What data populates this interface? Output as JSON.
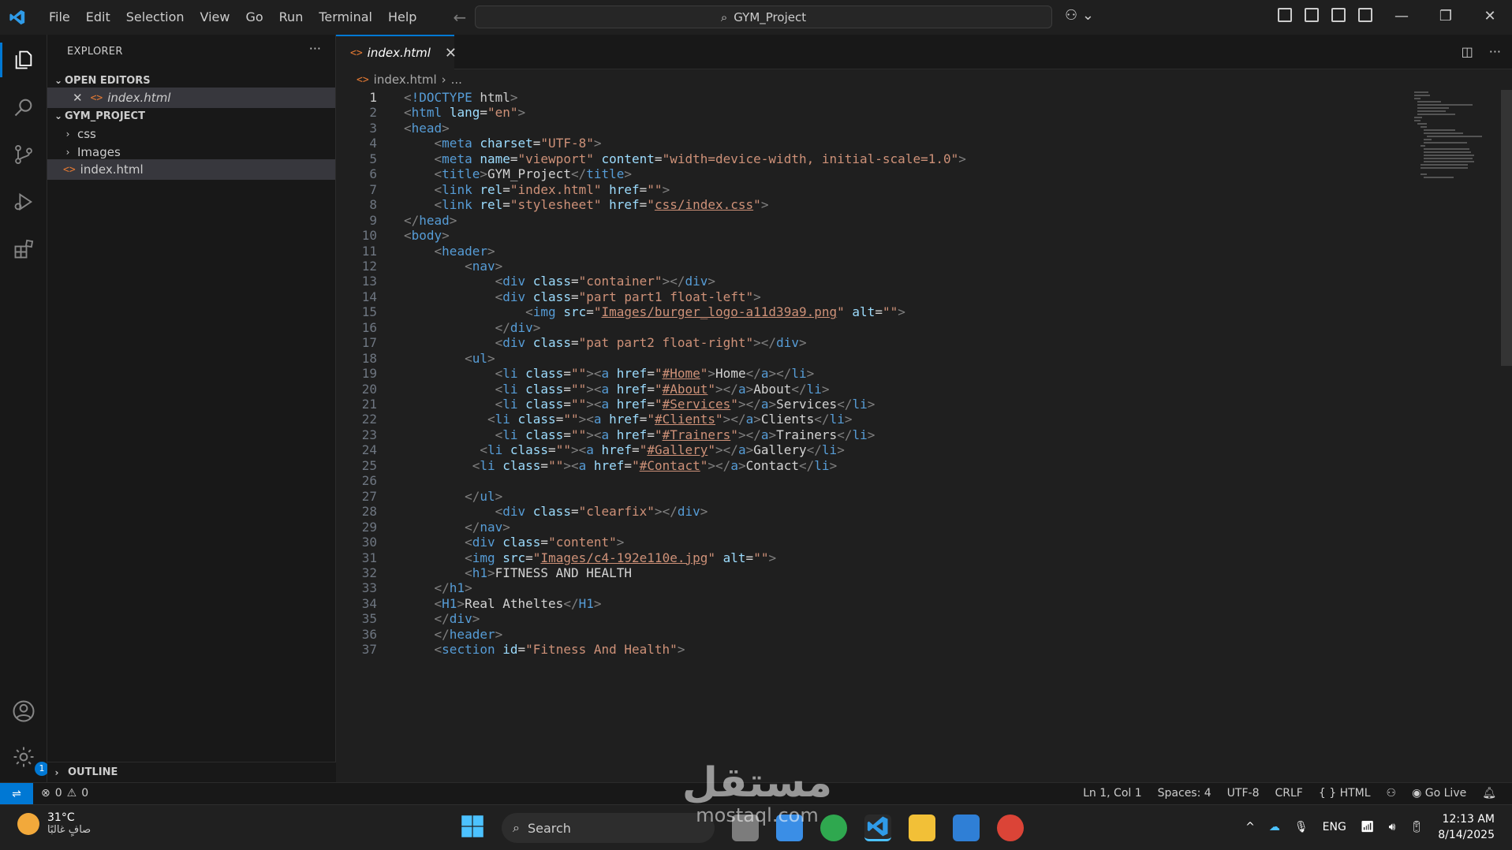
{
  "titlebar": {
    "menu": [
      "File",
      "Edit",
      "Selection",
      "View",
      "Go",
      "Run",
      "Terminal",
      "Help"
    ],
    "search": "GYM_Project"
  },
  "sidebar": {
    "title": "EXPLORER",
    "open_editors": "OPEN EDITORS",
    "open_file": "index.html",
    "project": "GYM_PROJECT",
    "folders": [
      "css",
      "Images"
    ],
    "file": "index.html",
    "outline": "OUTLINE"
  },
  "tab": {
    "name": "index.html"
  },
  "breadcrumb": {
    "file": "index.html",
    "rest": "..."
  },
  "colors": {
    "accent": "#0078d4",
    "tag": "#569cd6",
    "attr": "#9cdcfe",
    "string": "#ce9178"
  },
  "code": [
    "<!DOCTYPE html>",
    "<html lang=\"en\">",
    "<head>",
    "    <meta charset=\"UTF-8\">",
    "    <meta name=\"viewport\" content=\"width=device-width, initial-scale=1.0\">",
    "    <title>GYM_Project</title>",
    "    <link rel=\"index.html\" href=\"\">",
    "    <link rel=\"stylesheet\" href=\"css/index.css\">",
    "</head>",
    "<body>",
    "    <header>",
    "        <nav>",
    "            <div class=\"container\"></div>",
    "            <div class=\"part part1 float-left\">",
    "                <img src=\"Images/burger_logo-a11d39a9.png\" alt=\"\">",
    "            </div>",
    "            <div class=\"pat part2 float-right\"></div>",
    "        <ul>",
    "            <li class=\"\"><a href=\"#Home\">Home</a></li>",
    "            <li class=\"\"><a href=\"#About\"></a>About</li>",
    "            <li class=\"\"><a href=\"#Services\"></a>Services</li>",
    "           <li class=\"\"><a href=\"#Clients\"></a>Clients</li>",
    "            <li class=\"\"><a href=\"#Trainers\"></a>Trainers</li>",
    "          <li class=\"\"><a href=\"#Gallery\"></a>Gallery</li>",
    "         <li class=\"\"><a href=\"#Contact\"></a>Contact</li>",
    "",
    "        </ul>",
    "            <div class=\"clearfix\"></div>",
    "        </nav>",
    "        <div class=\"content\">",
    "        <img src=\"Images/c4-192e110e.jpg\" alt=\"\">",
    "        <h1>FITNESS AND HEALTH",
    "    </h1>",
    "    <H1>Real Atheltes</H1>",
    "    </div>",
    "    </header>",
    "    <section id=\"Fitness And Health\">"
  ],
  "statusbar": {
    "errors": "0",
    "warnings": "0",
    "position": "Ln 1, Col 1",
    "spaces": "Spaces: 4",
    "encoding": "UTF-8",
    "eol": "CRLF",
    "language": "HTML",
    "golive": "Go Live"
  },
  "taskbar": {
    "temp": "31°C",
    "weather": "صافٍ غالبًا",
    "search": "Search",
    "lang": "ENG",
    "time": "12:13 AM",
    "date": "8/14/2025",
    "badge": "1"
  },
  "watermark": {
    "ar": "مستقل",
    "latin": "mostaql.com"
  }
}
